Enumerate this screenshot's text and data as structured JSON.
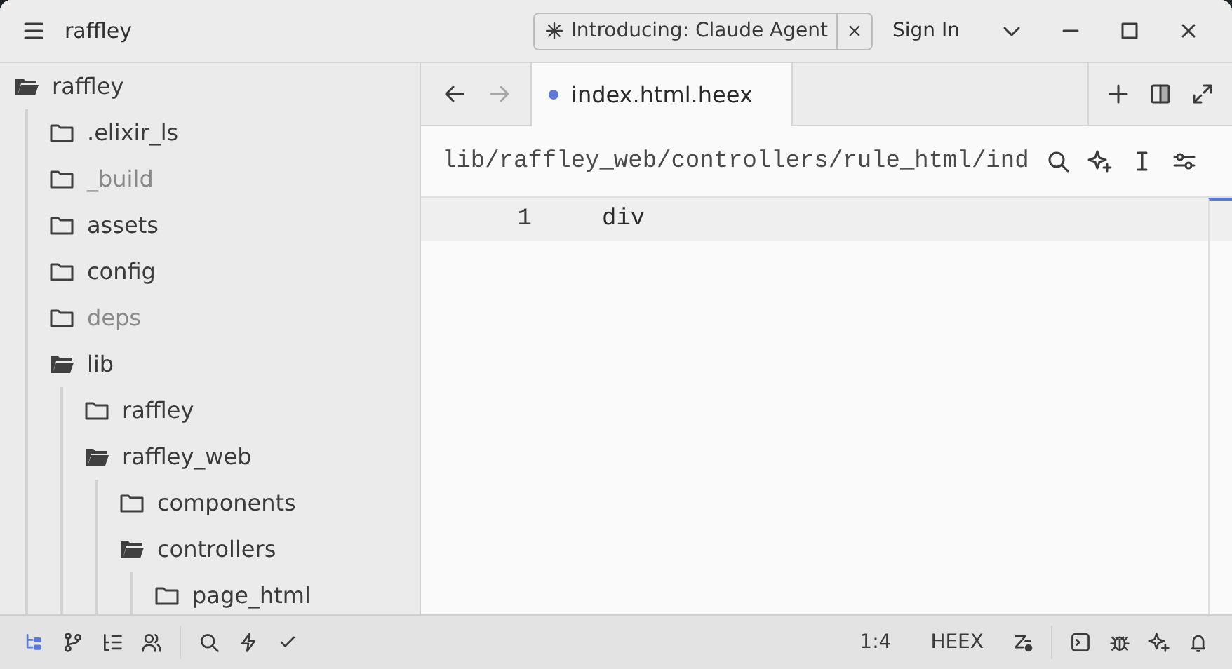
{
  "window": {
    "title": "raffley"
  },
  "banner": {
    "label": "Introducing: Claude Agent"
  },
  "account": {
    "label": "Sign In"
  },
  "sidebar": {
    "tree": [
      {
        "name": "raffley",
        "expanded": true,
        "ignored": false,
        "children": [
          {
            "name": ".elixir_ls",
            "expanded": false,
            "ignored": false
          },
          {
            "name": "_build",
            "expanded": false,
            "ignored": true
          },
          {
            "name": "assets",
            "expanded": false,
            "ignored": false
          },
          {
            "name": "config",
            "expanded": false,
            "ignored": false
          },
          {
            "name": "deps",
            "expanded": false,
            "ignored": true
          },
          {
            "name": "lib",
            "expanded": true,
            "ignored": false,
            "children": [
              {
                "name": "raffley",
                "expanded": false,
                "ignored": false
              },
              {
                "name": "raffley_web",
                "expanded": true,
                "ignored": false,
                "children": [
                  {
                    "name": "components",
                    "expanded": false,
                    "ignored": false
                  },
                  {
                    "name": "controllers",
                    "expanded": true,
                    "ignored": false,
                    "children": [
                      {
                        "name": "page_html",
                        "expanded": false,
                        "ignored": false
                      }
                    ]
                  }
                ]
              }
            ]
          }
        ]
      }
    ]
  },
  "editor": {
    "history": {
      "can_go_back": true,
      "can_go_forward": false
    },
    "tabs": [
      {
        "label": "index.html.heex",
        "selected": true,
        "modified": true
      }
    ],
    "breadcrumb": "lib/raffley_web/controllers/rule_html/ind",
    "lines": [
      {
        "number": "1",
        "text": "div",
        "current": true
      }
    ]
  },
  "status_bar": {
    "panels": [
      {
        "kind": "tree",
        "selected": true
      },
      {
        "kind": "branch",
        "selected": false
      },
      {
        "kind": "outline",
        "selected": false
      },
      {
        "kind": "people",
        "selected": false
      }
    ],
    "tools": [
      {
        "kind": "search"
      },
      {
        "kind": "bolt"
      },
      {
        "kind": "check"
      }
    ],
    "cursor": "1:4",
    "language": "HEEX",
    "right_tools": [
      {
        "kind": "zed"
      },
      {
        "kind": "terminal"
      },
      {
        "kind": "bug"
      },
      {
        "kind": "sparkle"
      },
      {
        "kind": "bell"
      }
    ]
  }
}
